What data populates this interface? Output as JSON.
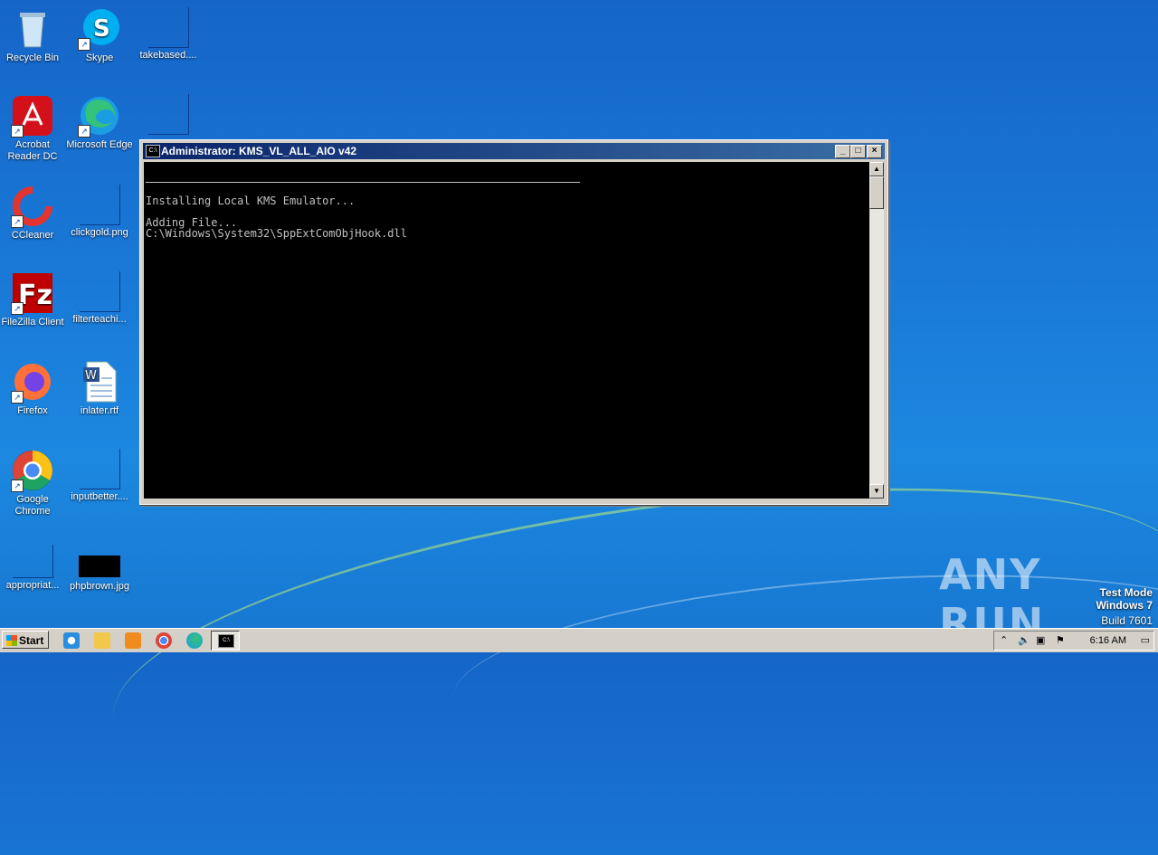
{
  "desktop": {
    "icons": [
      {
        "label": "Recycle Bin"
      },
      {
        "label": "Skype"
      },
      {
        "label": "takebased...."
      },
      {
        "label": "Acrobat Reader DC"
      },
      {
        "label": "Microsoft Edge"
      },
      {
        "label": "CCleaner"
      },
      {
        "label": "clickgold.png"
      },
      {
        "label": "FileZilla Client"
      },
      {
        "label": "filterteachi..."
      },
      {
        "label": "Firefox"
      },
      {
        "label": "inlater.rtf"
      },
      {
        "label": "Google Chrome"
      },
      {
        "label": "inputbetter...."
      },
      {
        "label": "appropriat..."
      },
      {
        "label": "phpbrown.jpg"
      }
    ]
  },
  "window": {
    "title": "Administrator:  KMS_VL_ALL_AIO v42",
    "lines": [
      "Installing Local KMS Emulator...",
      "Adding File...",
      "C:\\Windows\\System32\\SppExtComObjHook.dll"
    ]
  },
  "watermark": {
    "logo_text": "ANY RUN",
    "line1": "Test Mode",
    "line2": "Windows 7",
    "line3": "Build 7601"
  },
  "taskbar": {
    "start_label": "Start",
    "clock": "6:16 AM"
  },
  "colors": {
    "desktop_bg": "#1a7ad8",
    "titlebar": "#0a246a",
    "console_bg": "#000000",
    "console_text": "#c0c0c0"
  }
}
